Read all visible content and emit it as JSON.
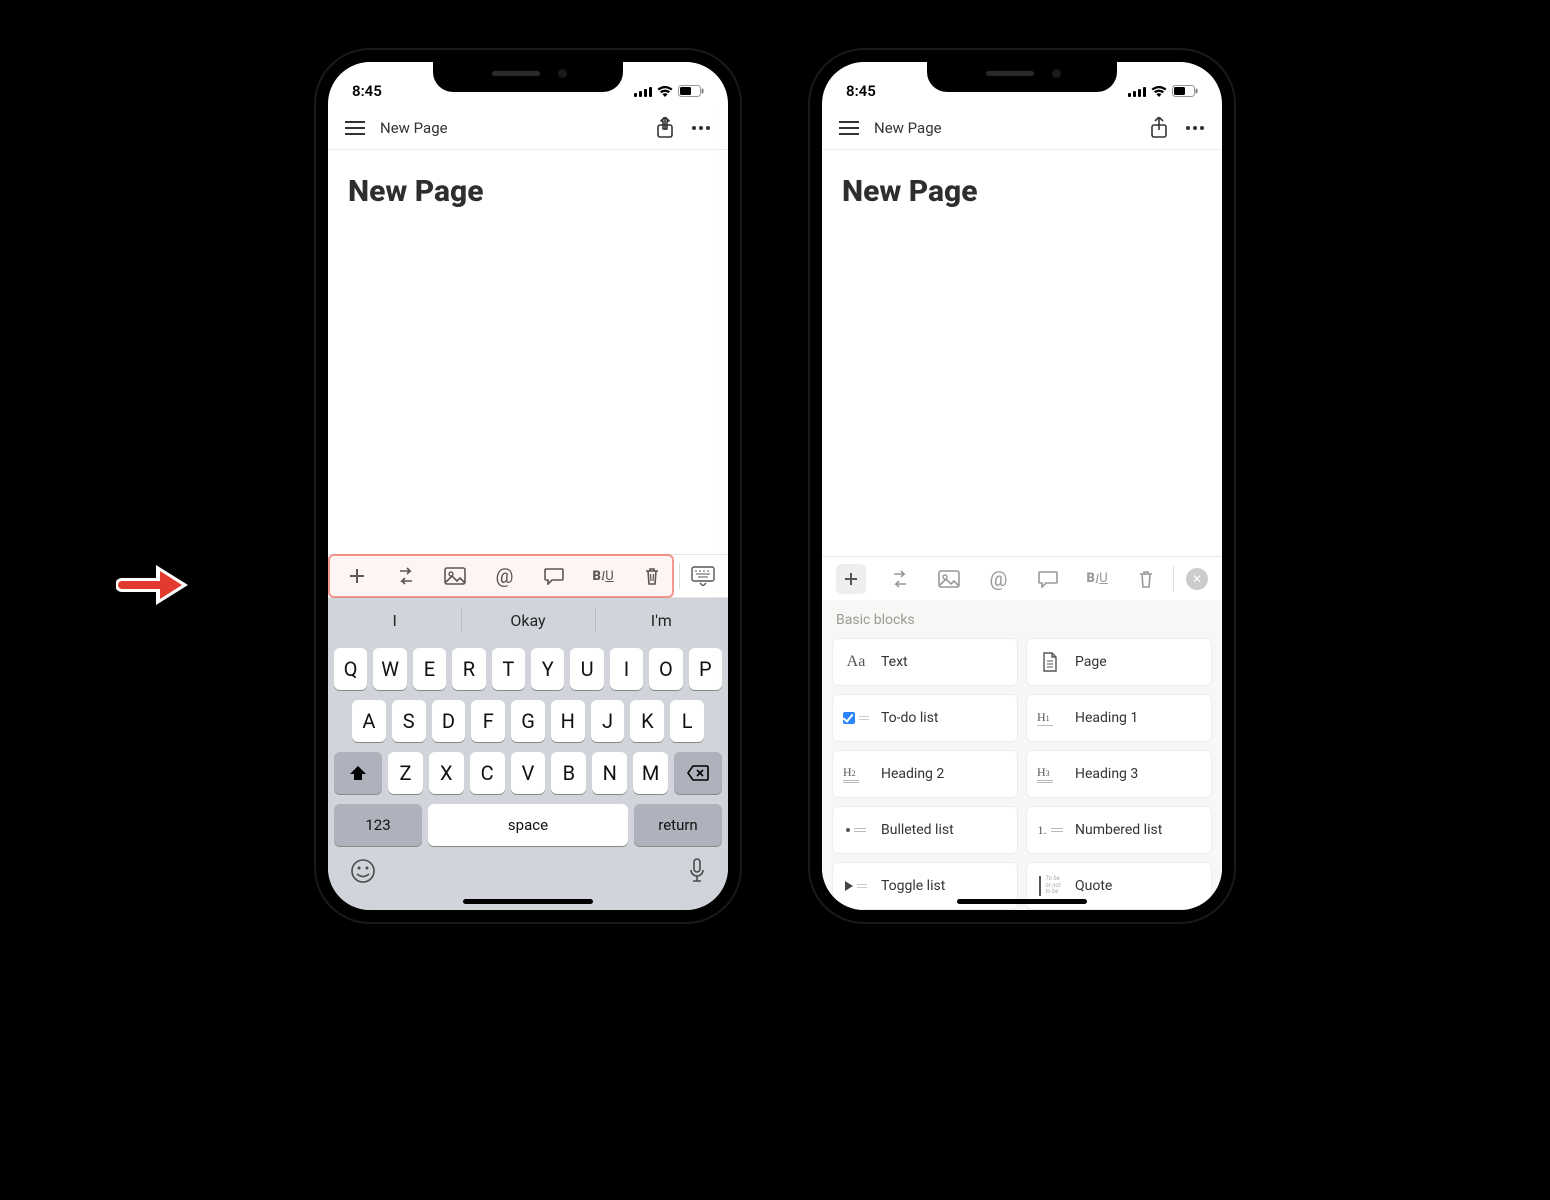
{
  "status": {
    "time": "8:45"
  },
  "nav": {
    "title": "New Page"
  },
  "page": {
    "heading": "New Page"
  },
  "toolbar": {
    "biu_b": "B",
    "biu_i": "I",
    "biu_u": "U"
  },
  "keyboard": {
    "predictions": [
      "I",
      "Okay",
      "I'm"
    ],
    "row1": [
      "Q",
      "W",
      "E",
      "R",
      "T",
      "Y",
      "U",
      "I",
      "O",
      "P"
    ],
    "row2": [
      "A",
      "S",
      "D",
      "F",
      "G",
      "H",
      "J",
      "K",
      "L"
    ],
    "row3": [
      "Z",
      "X",
      "C",
      "V",
      "B",
      "N",
      "M"
    ],
    "k123": "123",
    "space": "space",
    "return": "return"
  },
  "panel": {
    "title": "Basic blocks",
    "blocks": [
      {
        "label": "Text"
      },
      {
        "label": "Page"
      },
      {
        "label": "To-do list"
      },
      {
        "label": "Heading 1"
      },
      {
        "label": "Heading 2"
      },
      {
        "label": "Heading 3"
      },
      {
        "label": "Bulleted list"
      },
      {
        "label": "Numbered list"
      },
      {
        "label": "Toggle list"
      },
      {
        "label": "Quote"
      }
    ]
  },
  "quote_sample": "To be\nor not\nto be"
}
